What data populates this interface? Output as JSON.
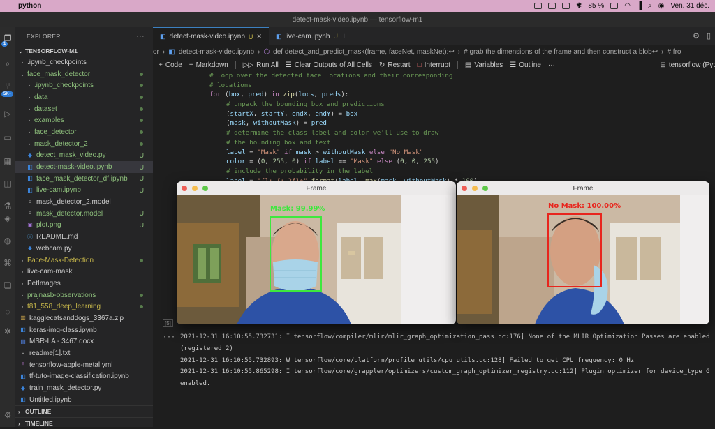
{
  "menubar": {
    "app": "python",
    "battery": "85 %",
    "date": "Ven. 31 déc."
  },
  "window": {
    "title": "detect-mask-video.ipynb — tensorflow-m1"
  },
  "activity": {
    "source_control_badge": "1",
    "extensions_badge": "5K+"
  },
  "explorer": {
    "header": "EXPLORER",
    "menu": "···",
    "root": "TENSORFLOW-M1",
    "items": [
      {
        "label": ".ipynb_checkpoints",
        "type": "folder",
        "collapsed": true,
        "indent": 1,
        "status": ""
      },
      {
        "label": "face_mask_detector",
        "type": "folder",
        "collapsed": false,
        "indent": 1,
        "status": "dot",
        "color": "green"
      },
      {
        "label": ".ipynb_checkpoints",
        "type": "folder",
        "collapsed": true,
        "indent": 2,
        "status": "dot",
        "color": "green"
      },
      {
        "label": "data",
        "type": "folder",
        "collapsed": true,
        "indent": 2,
        "status": "dot",
        "color": "green"
      },
      {
        "label": "dataset",
        "type": "folder",
        "collapsed": true,
        "indent": 2,
        "status": "dot",
        "color": "green"
      },
      {
        "label": "examples",
        "type": "folder",
        "collapsed": true,
        "indent": 2,
        "status": "dot",
        "color": "green"
      },
      {
        "label": "face_detector",
        "type": "folder",
        "collapsed": true,
        "indent": 2,
        "status": "dot",
        "color": "green"
      },
      {
        "label": "mask_detector_2",
        "type": "folder",
        "collapsed": true,
        "indent": 2,
        "status": "dot",
        "color": "green"
      },
      {
        "label": "detect_mask_video.py",
        "type": "py",
        "indent": 2,
        "status": "U",
        "color": "green"
      },
      {
        "label": "detect-mask-video.ipynb",
        "type": "nb",
        "indent": 2,
        "status": "U",
        "color": "green",
        "selected": true
      },
      {
        "label": "face_mask_detector_df.ipynb",
        "type": "nb",
        "indent": 2,
        "status": "U",
        "color": "green"
      },
      {
        "label": "live-cam.ipynb",
        "type": "nb",
        "indent": 2,
        "status": "U",
        "color": "green"
      },
      {
        "label": "mask_detector_2.model",
        "type": "file",
        "indent": 2,
        "status": "",
        "color": "plain"
      },
      {
        "label": "mask_detector.model",
        "type": "file",
        "indent": 2,
        "status": "U",
        "color": "green"
      },
      {
        "label": "plot.png",
        "type": "img",
        "indent": 2,
        "status": "U",
        "color": "green"
      },
      {
        "label": "README.md",
        "type": "md",
        "indent": 2,
        "status": "",
        "color": "plain"
      },
      {
        "label": "webcam.py",
        "type": "py",
        "indent": 2,
        "status": "",
        "color": "plain"
      },
      {
        "label": "Face-Mask-Detection",
        "type": "folder",
        "collapsed": true,
        "indent": 1,
        "status": "dot",
        "color": "yellow"
      },
      {
        "label": "live-cam-mask",
        "type": "folder",
        "collapsed": true,
        "indent": 1,
        "status": "",
        "color": "plain"
      },
      {
        "label": "PetImages",
        "type": "folder",
        "collapsed": true,
        "indent": 1,
        "status": "",
        "color": "plain"
      },
      {
        "label": "prajnasb-observations",
        "type": "folder",
        "collapsed": true,
        "indent": 1,
        "status": "dot",
        "color": "green"
      },
      {
        "label": "t81_558_deep_learning",
        "type": "folder",
        "collapsed": true,
        "indent": 1,
        "status": "dot",
        "color": "yellow"
      },
      {
        "label": "kagglecatsanddogs_3367a.zip",
        "type": "zip",
        "indent": 1,
        "status": "",
        "color": "plain"
      },
      {
        "label": "keras-img-class.ipynb",
        "type": "nb",
        "indent": 1,
        "status": "",
        "color": "plain"
      },
      {
        "label": "MSR-LA - 3467.docx",
        "type": "doc",
        "indent": 1,
        "status": "",
        "color": "plain"
      },
      {
        "label": "readme[1].txt",
        "type": "txt",
        "indent": 1,
        "status": "",
        "color": "plain"
      },
      {
        "label": "tensorflow-apple-metal.yml",
        "type": "yml",
        "indent": 1,
        "status": "",
        "color": "plain"
      },
      {
        "label": "tf-tuto-image-classification.ipynb",
        "type": "nb",
        "indent": 1,
        "status": "",
        "color": "plain"
      },
      {
        "label": "train_mask_detector.py",
        "type": "py",
        "indent": 1,
        "status": "",
        "color": "plain"
      },
      {
        "label": "Untitled.ipynb",
        "type": "nb",
        "indent": 1,
        "status": "",
        "color": "plain"
      }
    ],
    "outline": "OUTLINE",
    "timeline": "TIMELINE"
  },
  "tabs": [
    {
      "label": "detect-mask-video.ipynb",
      "status": "U",
      "active": true
    },
    {
      "label": "live-cam.ipynb",
      "status": "U",
      "active": false
    }
  ],
  "breadcrumbs": [
    "or",
    "detect-mask-video.ipynb",
    "def detect_and_predict_mask(frame, faceNet, maskNet):↩",
    "# grab the dimensions of the frame and then construct a blob↩",
    "# fro"
  ],
  "toolbar": {
    "code": "Code",
    "markdown": "Markdown",
    "run_all": "Run All",
    "clear": "Clear Outputs of All Cells",
    "restart": "Restart",
    "interrupt": "Interrupt",
    "variables": "Variables",
    "outline": "Outline",
    "more": "···",
    "kernel": "tensorflow (Pyt"
  },
  "code_lines": [
    {
      "indent": 1,
      "parts": [
        [
          "cm",
          "# loop over the detected face locations and their corresponding"
        ]
      ]
    },
    {
      "indent": 1,
      "parts": [
        [
          "cm",
          "# locations"
        ]
      ]
    },
    {
      "indent": 1,
      "parts": [
        [
          "kw",
          "for"
        ],
        [
          "pl",
          " ("
        ],
        [
          "vr",
          "box"
        ],
        [
          "pl",
          ", "
        ],
        [
          "vr",
          "pred"
        ],
        [
          "pl",
          ") "
        ],
        [
          "kw",
          "in"
        ],
        [
          "pl",
          " "
        ],
        [
          "fn",
          "zip"
        ],
        [
          "pl",
          "("
        ],
        [
          "vr",
          "locs"
        ],
        [
          "pl",
          ", "
        ],
        [
          "vr",
          "preds"
        ],
        [
          "pl",
          "):"
        ]
      ]
    },
    {
      "indent": 2,
      "parts": [
        [
          "cm",
          "# unpack the bounding box and predictions"
        ]
      ]
    },
    {
      "indent": 2,
      "parts": [
        [
          "pl",
          "("
        ],
        [
          "vr",
          "startX"
        ],
        [
          "pl",
          ", "
        ],
        [
          "vr",
          "startY"
        ],
        [
          "pl",
          ", "
        ],
        [
          "vr",
          "endX"
        ],
        [
          "pl",
          ", "
        ],
        [
          "vr",
          "endY"
        ],
        [
          "pl",
          ") = "
        ],
        [
          "vr",
          "box"
        ]
      ]
    },
    {
      "indent": 2,
      "parts": [
        [
          "pl",
          "("
        ],
        [
          "vr",
          "mask"
        ],
        [
          "pl",
          ", "
        ],
        [
          "vr",
          "withoutMask"
        ],
        [
          "pl",
          ") = "
        ],
        [
          "vr",
          "pred"
        ]
      ]
    },
    {
      "indent": 2,
      "parts": [
        [
          "cm",
          "# determine the class label and color we'll use to draw"
        ]
      ]
    },
    {
      "indent": 2,
      "parts": [
        [
          "cm",
          "# the bounding box and text"
        ]
      ]
    },
    {
      "indent": 2,
      "parts": [
        [
          "vr",
          "label"
        ],
        [
          "pl",
          " = "
        ],
        [
          "st",
          "\"Mask\""
        ],
        [
          "pl",
          " "
        ],
        [
          "kw",
          "if"
        ],
        [
          "pl",
          " "
        ],
        [
          "vr",
          "mask"
        ],
        [
          "pl",
          " > "
        ],
        [
          "vr",
          "withoutMask"
        ],
        [
          "pl",
          " "
        ],
        [
          "kw",
          "else"
        ],
        [
          "pl",
          " "
        ],
        [
          "st",
          "\"No Mask\""
        ]
      ]
    },
    {
      "indent": 2,
      "parts": [
        [
          "vr",
          "color"
        ],
        [
          "pl",
          " = ("
        ],
        [
          "nu",
          "0"
        ],
        [
          "pl",
          ", "
        ],
        [
          "nu",
          "255"
        ],
        [
          "pl",
          ", "
        ],
        [
          "nu",
          "0"
        ],
        [
          "pl",
          ") "
        ],
        [
          "kw",
          "if"
        ],
        [
          "pl",
          " "
        ],
        [
          "vr",
          "label"
        ],
        [
          "pl",
          " == "
        ],
        [
          "st",
          "\"Mask\""
        ],
        [
          "pl",
          " "
        ],
        [
          "kw",
          "else"
        ],
        [
          "pl",
          " ("
        ],
        [
          "nu",
          "0"
        ],
        [
          "pl",
          ", "
        ],
        [
          "nu",
          "0"
        ],
        [
          "pl",
          ", "
        ],
        [
          "nu",
          "255"
        ],
        [
          "pl",
          ")"
        ]
      ]
    },
    {
      "indent": 2,
      "parts": [
        [
          "cm",
          "# include the probability in the label"
        ]
      ]
    },
    {
      "indent": 2,
      "parts": [
        [
          "vr",
          "label"
        ],
        [
          "pl",
          " = "
        ],
        [
          "st",
          "\"{}: {:.2f}%\""
        ],
        [
          "pl",
          "."
        ],
        [
          "fn",
          "format"
        ],
        [
          "pl",
          "("
        ],
        [
          "vr",
          "label"
        ],
        [
          "pl",
          ", "
        ],
        [
          "fn",
          "max"
        ],
        [
          "pl",
          "("
        ],
        [
          "vr",
          "mask"
        ],
        [
          "pl",
          ", "
        ],
        [
          "vr",
          "withoutMask"
        ],
        [
          "pl",
          ") * "
        ],
        [
          "nu",
          "100"
        ],
        [
          "pl",
          ")"
        ]
      ]
    }
  ],
  "cell_exec": "[5]",
  "output_prompt": "···",
  "output_lines": [
    "2021-12-31 16:10:55.732731: I tensorflow/compiler/mlir/mlir_graph_optimization_pass.cc:176] None of the MLIR Optimization Passes are enabled",
    "(registered 2)",
    "2021-12-31 16:10:55.732893: W tensorflow/core/platform/profile_utils/cpu_utils.cc:128] Failed to get CPU frequency: 0 Hz",
    "2021-12-31 16:10:55.865298: I tensorflow/core/grappler/optimizers/custom_graph_optimizer_registry.cc:112] Plugin optimizer for device_type G",
    "enabled."
  ],
  "frames": [
    {
      "title": "Frame",
      "label": "Mask: 99.99%",
      "label_color": "#3ee83e"
    },
    {
      "title": "Frame",
      "label": "No Mask: 100.00%",
      "label_color": "#e8251d"
    }
  ]
}
